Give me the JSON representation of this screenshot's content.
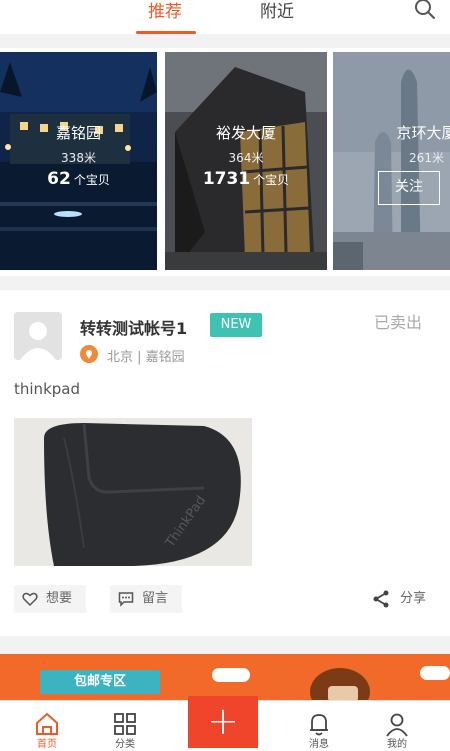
{
  "tabs": {
    "recommend": "推荐",
    "nearby": "附近"
  },
  "cards": [
    {
      "name": "嘉铭园",
      "distance": "338米",
      "count": "62",
      "count_unit": "个宝贝"
    },
    {
      "name": "裕发大厦",
      "distance": "364米",
      "count": "1731",
      "count_unit": "个宝贝"
    },
    {
      "name": "京环大厦",
      "distance": "261米",
      "follow_label": "关注"
    }
  ],
  "post": {
    "username": "转转测试帐号1",
    "badge": "NEW",
    "status": "已卖出",
    "location": "北京 | 嘉铭园",
    "title": "thinkpad",
    "photo_brand": "ThinkPad",
    "want_label": "想要",
    "comment_label": "留言",
    "share_label": "分享"
  },
  "banner": {
    "ribbon_label": "包邮专区"
  },
  "nav": [
    {
      "label": "首页"
    },
    {
      "label": "分类"
    },
    {
      "label": "消息"
    },
    {
      "label": "我的"
    }
  ],
  "colors": {
    "accent": "#f05a28",
    "badge": "#3ec3b3",
    "banner": "#f26a2a",
    "add_button": "#f0452a"
  }
}
